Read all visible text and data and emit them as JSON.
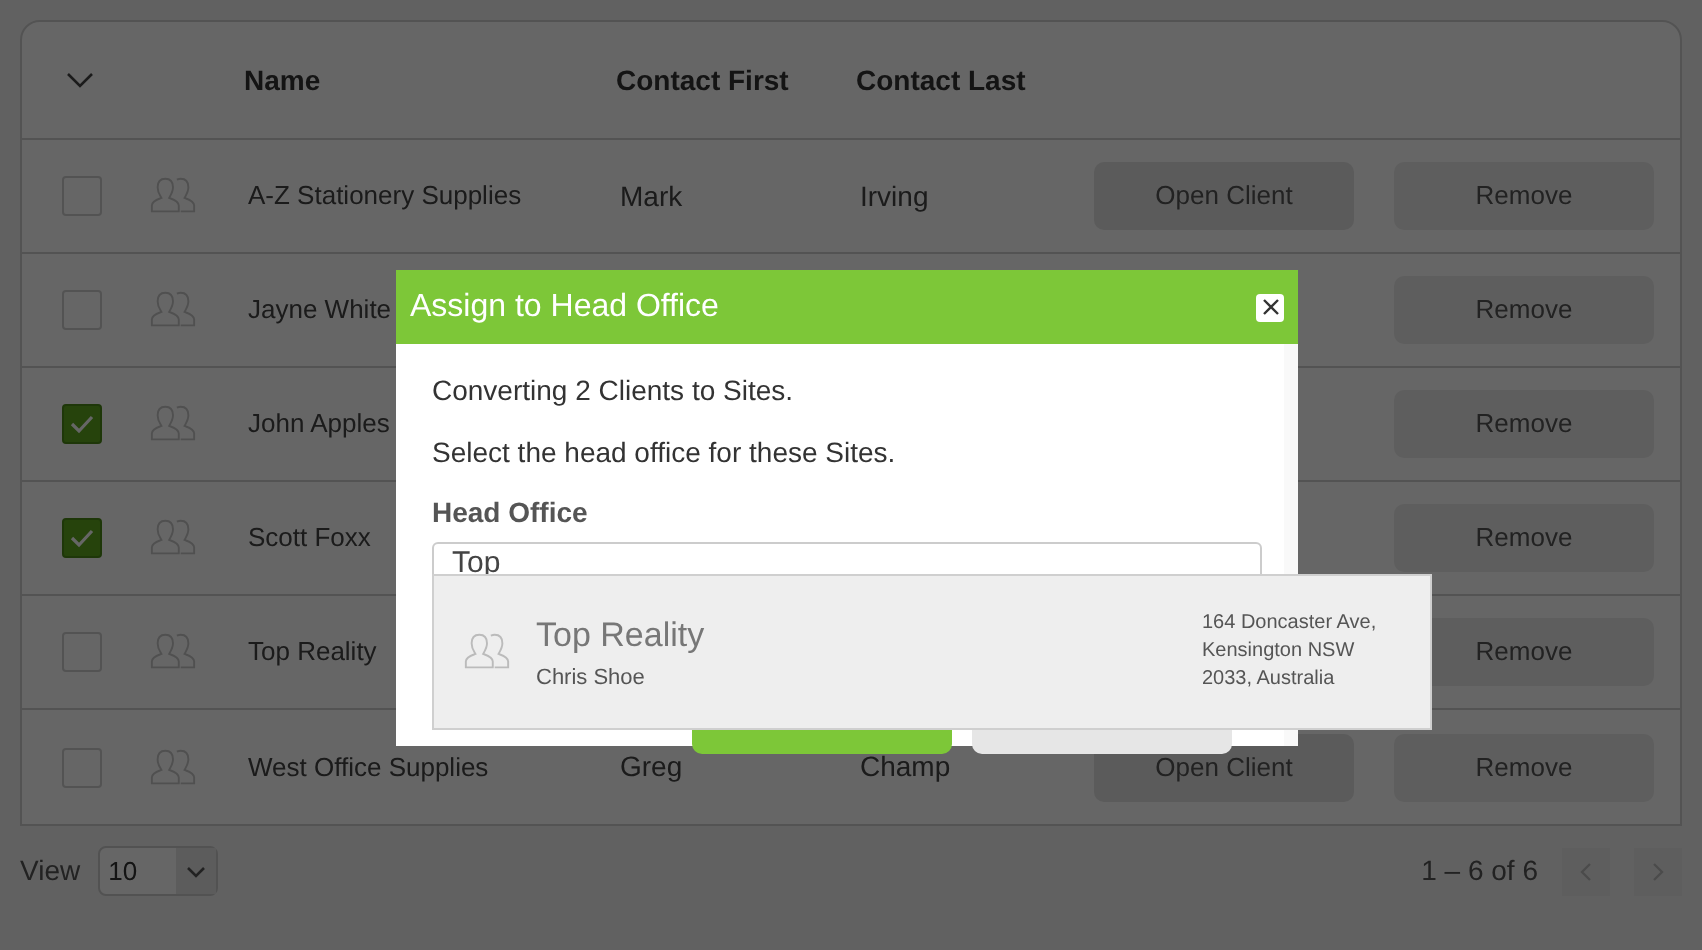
{
  "table": {
    "columns": [
      "Name",
      "Contact First",
      "Contact Last"
    ],
    "rows": [
      {
        "checked": false,
        "name": "A-Z Stationery Supplies",
        "contact_first": "Mark",
        "contact_last": "Irving",
        "open_button": "Open Client",
        "remove_button": "Remove"
      },
      {
        "checked": false,
        "name": "Jayne White",
        "remove_button": "Remove"
      },
      {
        "checked": true,
        "name": "John Apples",
        "remove_button": "Remove"
      },
      {
        "checked": true,
        "name": "Scott Foxx",
        "remove_button": "Remove"
      },
      {
        "checked": false,
        "name": "Top Reality",
        "remove_button": "Remove"
      },
      {
        "checked": false,
        "name": "West Office Supplies",
        "contact_first": "Greg",
        "contact_last": "Champ",
        "open_button": "Open Client",
        "remove_button": "Remove"
      }
    ]
  },
  "footer": {
    "view_label": "View",
    "page_size": "10",
    "range": "1 – 6 of 6"
  },
  "dialog": {
    "title": "Assign to Head Office",
    "message": "Converting 2 Clients to Sites.",
    "instruction": "Select the head office for these Sites.",
    "field_label": "Head Office",
    "field_value": "Top",
    "suggestions": [
      {
        "name": "Top Reality",
        "contact": "Chris Shoe",
        "address": [
          "164 Doncaster Ave,",
          "Kensington NSW",
          "2033, Australia"
        ]
      }
    ]
  }
}
